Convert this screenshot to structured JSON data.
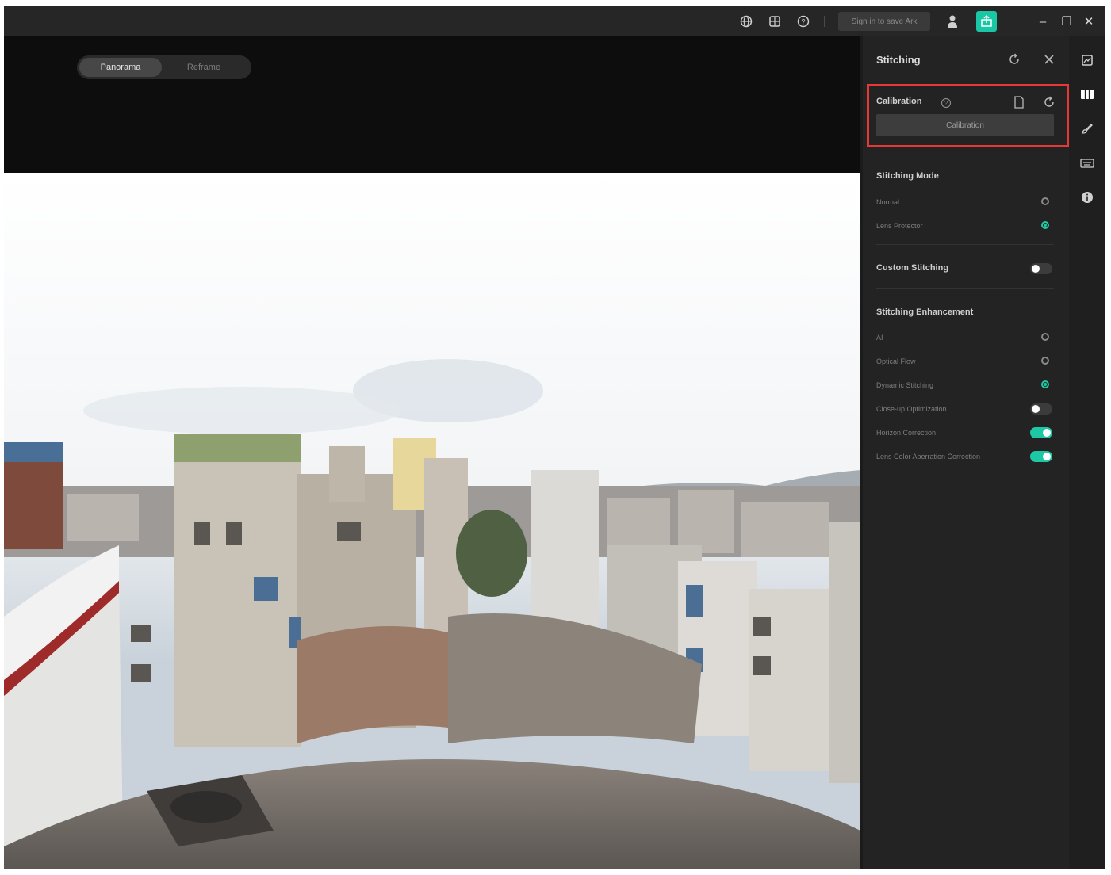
{
  "titlebar": {
    "signin_label": "Sign in to save Ark",
    "icons": [
      "globe-icon",
      "grid-icon",
      "help-icon"
    ],
    "window_controls": {
      "minimize": "–",
      "restore": "❐",
      "close": "✕"
    },
    "export_icon": "export-icon",
    "user_icon": "user-icon"
  },
  "preview": {
    "view_modes": [
      "Panorama",
      "Reframe"
    ],
    "active_view_mode": "Panorama"
  },
  "panel": {
    "title": "Stitching",
    "calibration": {
      "label": "Calibration",
      "button_label": "Calibration"
    },
    "stitching_mode": {
      "title": "Stitching Mode",
      "options": [
        {
          "label": "Normal",
          "selected": false
        },
        {
          "label": "Lens Protector",
          "selected": true
        }
      ]
    },
    "custom_stitching": {
      "label": "Custom Stitching",
      "enabled": false
    },
    "stitching_enhancement": {
      "title": "Stitching Enhancement",
      "radio_options": [
        {
          "label": "AI",
          "selected": false
        },
        {
          "label": "Optical Flow",
          "selected": false
        },
        {
          "label": "Dynamic Stitching",
          "selected": true
        }
      ],
      "toggles": [
        {
          "label": "Close-up Optimization",
          "enabled": false
        },
        {
          "label": "Horizon Correction",
          "enabled": true
        },
        {
          "label": "Lens Color Aberration Correction",
          "enabled": true
        }
      ]
    }
  },
  "colors": {
    "accent": "#1fc8a5",
    "highlight_border": "#e53935",
    "panel_bg": "#232323"
  }
}
